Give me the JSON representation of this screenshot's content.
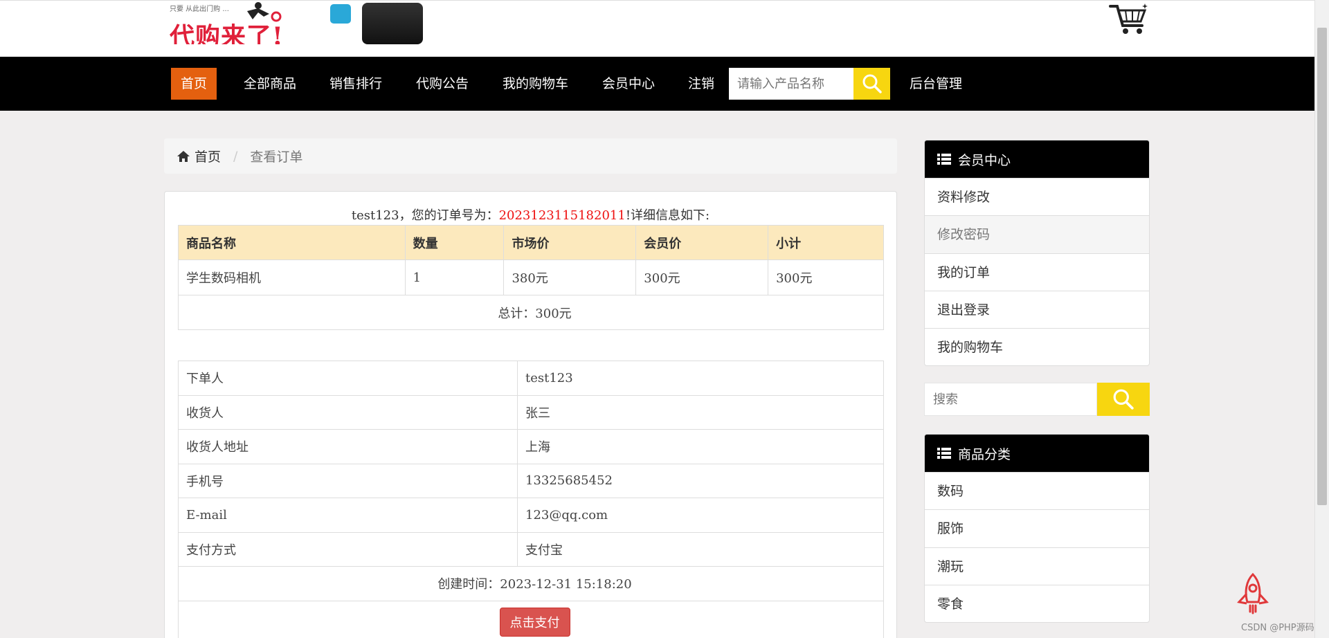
{
  "header": {
    "logo_text": "代购来了!",
    "logo_sub": "只要 从此出门购 ..."
  },
  "nav": {
    "items": [
      {
        "label": "首页",
        "active": true
      },
      {
        "label": "全部商品"
      },
      {
        "label": "销售排行"
      },
      {
        "label": "代购公告"
      },
      {
        "label": "我的购物车"
      },
      {
        "label": "会员中心"
      },
      {
        "label": "注销"
      }
    ],
    "search_placeholder": "请输入产品名称",
    "admin_label": "后台管理"
  },
  "breadcrumb": {
    "home": "首页",
    "separator": "/",
    "current": "查看订单"
  },
  "order": {
    "user": "test123",
    "prefix_sep": "，您的订单号为：",
    "number": "2023123115182011",
    "suffix": "!详细信息如下:",
    "columns": [
      "商品名称",
      "数量",
      "市场价",
      "会员价",
      "小计"
    ],
    "items": [
      {
        "name": "学生数码相机",
        "qty": "1",
        "market_price": "380元",
        "member_price": "300元",
        "subtotal": "300元"
      }
    ],
    "total": "总计：300元",
    "info": [
      {
        "label": "下单人",
        "value": "test123"
      },
      {
        "label": "收货人",
        "value": "张三"
      },
      {
        "label": "收货人地址",
        "value": "上海"
      },
      {
        "label": "手机号",
        "value": "13325685452"
      },
      {
        "label": "E-mail",
        "value": "123@qq.com"
      },
      {
        "label": "支付方式",
        "value": "支付宝"
      }
    ],
    "created": "创建时间：2023-12-31 15:18:20",
    "pay_button": "点击支付"
  },
  "sidebar": {
    "member_title": "会员中心",
    "member_items": [
      "资料修改",
      "修改密码",
      "我的订单",
      "退出登录",
      "我的购物车"
    ],
    "search_placeholder": "搜索",
    "category_title": "商品分类",
    "categories": [
      "数码",
      "服饰",
      "潮玩",
      "零食"
    ]
  },
  "watermark": "CSDN @PHP源码",
  "colors": {
    "nav_active": "#e4600f",
    "search_button": "#f7d610",
    "order_number": "#ee1111",
    "table_header": "#fce9bd",
    "pay_button": "#d9534f"
  }
}
